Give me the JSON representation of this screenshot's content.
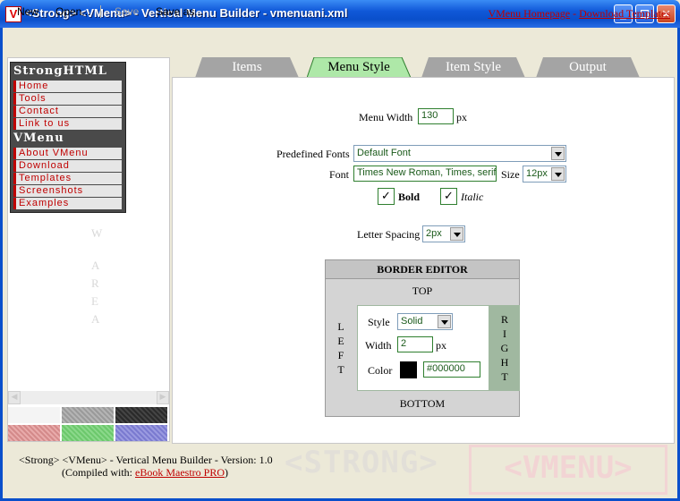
{
  "window": {
    "title": "<Strong> <VMenu> - Vertical Menu Builder - vmenuani.xml",
    "icon_letter": "V",
    "min_glyph": "_",
    "max_glyph": "☐",
    "close_glyph": "✕"
  },
  "toolbar": {
    "new": "New",
    "open": "Open...",
    "save": "Save",
    "save_as": "Save as...",
    "homepage_link": "VMenu Homepage",
    "link_sep": " - ",
    "download_link": "Download Templates"
  },
  "preview": {
    "group1_title": "StrongHTML",
    "group1_items": [
      "Home",
      "Tools",
      "Contact",
      "Link to us"
    ],
    "group2_title": "VMenu",
    "group2_items": [
      "About VMenu",
      "Download",
      "Templates",
      "Screenshots",
      "Examples"
    ],
    "watermark": [
      "W",
      "A",
      "R",
      "E",
      "A"
    ],
    "scroll_left": "◀",
    "scroll_right": "▶"
  },
  "tabs": [
    {
      "label": "Items",
      "active": false
    },
    {
      "label": "Menu Style",
      "active": true
    },
    {
      "label": "Item Style",
      "active": false
    },
    {
      "label": "Output",
      "active": false
    }
  ],
  "menu_style": {
    "menu_width_label": "Menu Width",
    "menu_width_value": "130",
    "menu_width_unit": "px",
    "predefined_fonts_label": "Predefined Fonts",
    "predefined_fonts_value": "Default Font",
    "font_label": "Font",
    "font_value": "Times New Roman, Times, serif",
    "size_label": "Size",
    "size_value": "12px",
    "bold_label": "Bold",
    "bold_checked": "✓",
    "italic_label": "Italic",
    "italic_checked": "✓",
    "letter_spacing_label": "Letter Spacing",
    "letter_spacing_value": "2px"
  },
  "border_editor": {
    "title": "BORDER EDITOR",
    "top": "TOP",
    "bottom": "BOTTOM",
    "left_letters": [
      "L",
      "E",
      "F",
      "T"
    ],
    "right_letters": [
      "R",
      "I",
      "G",
      "H",
      "T"
    ],
    "style_label": "Style",
    "style_value": "Solid",
    "width_label": "Width",
    "width_value": "2",
    "width_unit": "px",
    "color_label": "Color",
    "color_value": "#000000",
    "swatch_color": "#000000"
  },
  "footer": {
    "line1": "<Strong> <VMenu> - Vertical Menu Builder - Version: 1.0",
    "line2_prefix": "(Compiled with: ",
    "line2_link": "eBook Maestro PRO",
    "line2_suffix": ")",
    "watermark_strong": "<STRONG>",
    "watermark_vmenu": "<VMENU>"
  },
  "colors": {
    "accent_link": "#c00000",
    "active_tab": "#aee8a8",
    "inactive_tab": "#a4a4a4"
  }
}
